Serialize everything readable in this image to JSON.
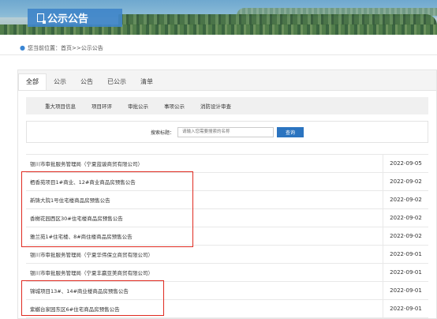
{
  "banner": {
    "title": "公示公告"
  },
  "breadcrumb": {
    "prefix": "您当前位置：",
    "home": "首页",
    "sep": " >> ",
    "current": "公示公告"
  },
  "tabs": [
    "全部",
    "公示",
    "公告",
    "已公示",
    "清单"
  ],
  "subnav": [
    "重大项目信息",
    "项目环评",
    "审批公示",
    "事项公示",
    "消防设计审查"
  ],
  "search": {
    "label": "搜索标题：",
    "placeholder": "请输入您需要搜索的名称",
    "button": "查询"
  },
  "rows": [
    {
      "title": "银川市审批服务管理局（宁夏蓝骏商贸有限公司）",
      "date": "2022-09-05"
    },
    {
      "title": "栖香苑项目1#商业、12#商业商品房预售公告",
      "date": "2022-09-02"
    },
    {
      "title": "新铸大院1号住宅楼商品房预售公告",
      "date": "2022-09-02"
    },
    {
      "title": "香榭花园西区30#住宅楼商品房预售公告",
      "date": "2022-09-02"
    },
    {
      "title": "雅兰苑1#住宅楼、8#商住楼商品房预售公告",
      "date": "2022-09-02"
    },
    {
      "title": "银川市审批服务管理局（宁夏华伟保立商贸有限公司）",
      "date": "2022-09-01"
    },
    {
      "title": "银川市审批服务管理局（宁夏丰赢亚美商贸有限公司）",
      "date": "2022-09-01"
    },
    {
      "title": "锦城项目13#、14#商业楼商品房预售公告",
      "date": "2022-09-01"
    },
    {
      "title": "紫樾台家园东区6#住宅商品房预售公告",
      "date": "2022-09-01"
    }
  ],
  "colors": {
    "accent": "#2b74c0",
    "highlight": "#e02a20"
  }
}
